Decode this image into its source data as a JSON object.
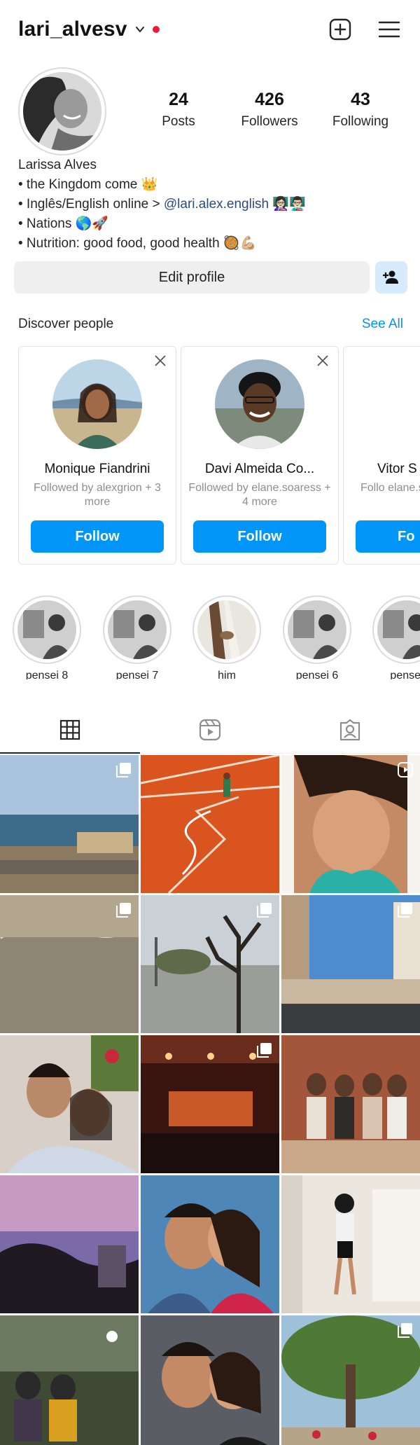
{
  "header": {
    "username": "lari_alvesv",
    "icons": [
      "chevron-down-icon",
      "notification-dot",
      "new-post-icon",
      "menu-icon"
    ],
    "notification_color": "#ed1a3a"
  },
  "profile": {
    "stats": [
      {
        "value": "24",
        "label": "Posts"
      },
      {
        "value": "426",
        "label": "Followers"
      },
      {
        "value": "43",
        "label": "Following"
      }
    ],
    "name": "Larissa Alves",
    "bio_lines": [
      {
        "text": "• the Kingdom come 👑"
      },
      {
        "text": "• Inglês/English online > ",
        "handle": "@lari.alex.english",
        "suffix": " 👩🏻‍🏫👨🏻‍🏫"
      },
      {
        "text": "• Nations 🌎🚀"
      },
      {
        "text": "• Nutrition: good food, good health 🥘💪🏼"
      }
    ],
    "edit_label": "Edit profile"
  },
  "discover": {
    "title": "Discover people",
    "see_all": "See All",
    "cards": [
      {
        "name": "Monique Fiandrini",
        "sub": "Followed by alexgrion + 3 more",
        "follow": "Follow"
      },
      {
        "name": "Davi Almeida Co...",
        "sub": "Followed by elane.soaress + 4 more",
        "follow": "Follow"
      },
      {
        "name": "Vitor S",
        "sub": "Follo elane.soare",
        "follow": "Fo"
      }
    ]
  },
  "highlights": [
    {
      "label": "pensei 8"
    },
    {
      "label": "pensei 7"
    },
    {
      "label": "him"
    },
    {
      "label": "pensei 6"
    },
    {
      "label": "pensei"
    }
  ],
  "tabs": [
    "grid-icon",
    "reels-icon",
    "tagged-icon"
  ],
  "accent": "#0095f6"
}
